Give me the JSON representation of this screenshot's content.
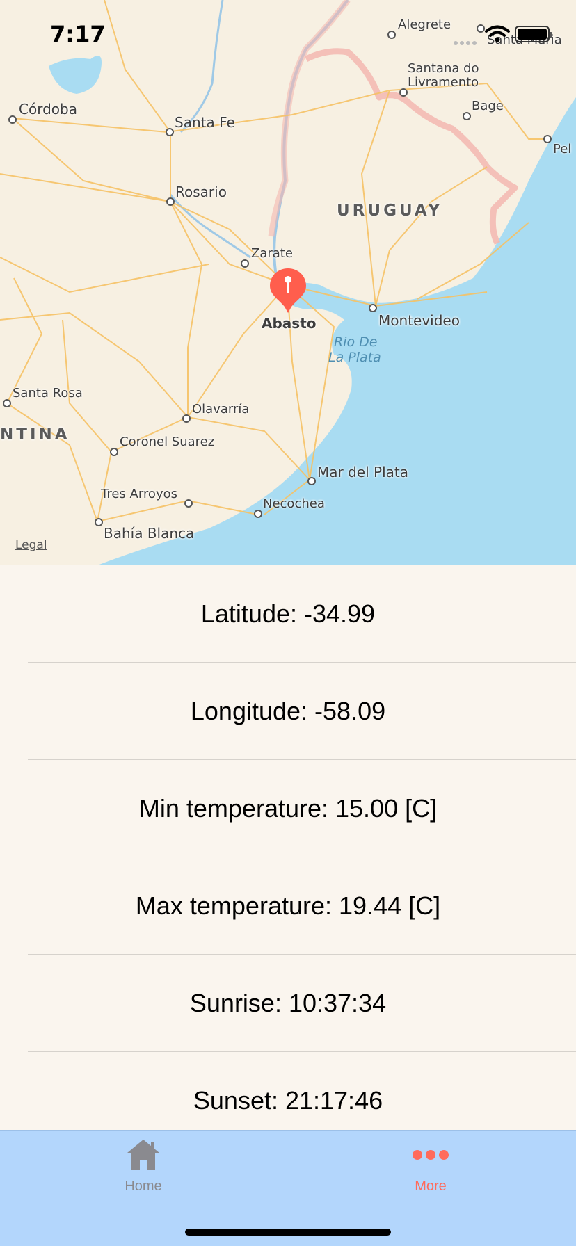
{
  "status_bar": {
    "time": "7:17"
  },
  "map": {
    "legal_label": "Legal",
    "pin_label": "Abasto",
    "labels": {
      "cordoba": "Córdoba",
      "santa_fe": "Santa Fe",
      "rosario": "Rosario",
      "zarate": "Zarate",
      "uruguay": "URUGUAY",
      "alegrete": "Alegrete",
      "santa_maria": "Santa Maria",
      "santana_line1": "Santana do",
      "santana_line2": "Livramento",
      "bage": "Bage",
      "pel": "Pel",
      "montevideo": "Montevideo",
      "rio_line1": "Rio De",
      "rio_line2": "La Plata",
      "santa_rosa": "Santa Rosa",
      "ntina": "NTINA",
      "olavarria": "Olavarría",
      "coronel_suarez": "Coronel Suarez",
      "mar_del_plata": "Mar del Plata",
      "tres_arroyos": "Tres Arroyos",
      "necochea": "Necochea",
      "bahia_blanca": "Bahía Blanca"
    }
  },
  "weather": {
    "latitude": "Latitude: -34.99",
    "longitude": "Longitude: -58.09",
    "min_temp": "Min temperature: 15.00 [C]",
    "max_temp": "Max temperature: 19.44 [C]",
    "sunrise": "Sunrise: 10:37:34",
    "sunset": "Sunset: 21:17:46"
  },
  "tabbar": {
    "home_label": "Home",
    "more_label": "More",
    "home_icon": "house-icon",
    "more_icon": "ellipsis-icon",
    "active_color": "#ff6b5c",
    "inactive_color": "#8a8a8f"
  }
}
